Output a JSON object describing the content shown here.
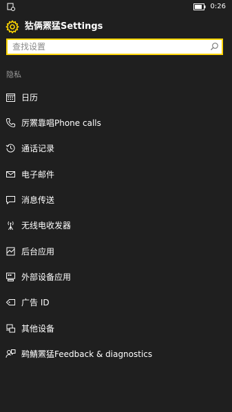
{
  "status_bar": {
    "time": "0:26"
  },
  "header": {
    "title": "狜俩罴猛Settings"
  },
  "search": {
    "placeholder": "查找设置"
  },
  "section": {
    "label": "隐私"
  },
  "menu_items": [
    {
      "label": "日历",
      "icon": "calendar-icon"
    },
    {
      "label": "厉罴靠唱Phone calls",
      "icon": "phone-icon"
    },
    {
      "label": "通话记录",
      "icon": "history-icon"
    },
    {
      "label": "电子邮件",
      "icon": "mail-icon"
    },
    {
      "label": "消息传送",
      "icon": "message-icon"
    },
    {
      "label": "无线电收发器",
      "icon": "antenna-icon"
    },
    {
      "label": "后台应用",
      "icon": "background-apps-icon"
    },
    {
      "label": "外部设备应用",
      "icon": "device-apps-icon"
    },
    {
      "label": "广告 ID",
      "icon": "tag-icon"
    },
    {
      "label": "其他设备",
      "icon": "devices-icon"
    },
    {
      "label": "鹀鯖罴猛Feedback & diagnostics",
      "icon": "feedback-icon"
    }
  ]
}
